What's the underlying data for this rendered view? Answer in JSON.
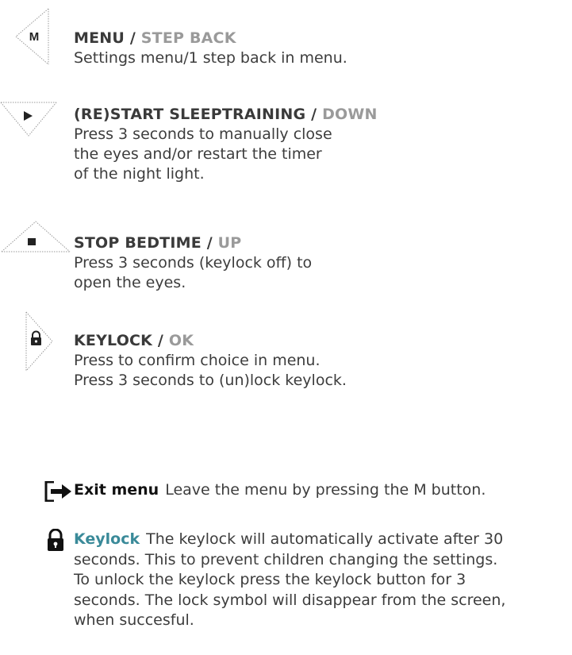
{
  "buttons": [
    {
      "icon": "menu-button-icon",
      "glyph": "M",
      "title_main": "MENU / ",
      "title_alt": "STEP BACK",
      "lines": [
        "Settings menu/1 step back in menu."
      ]
    },
    {
      "icon": "play-button-icon",
      "glyph": "▶",
      "title_main": "(RE)START SLEEPTRAINING / ",
      "title_alt": "DOWN",
      "lines": [
        "Press 3 seconds to manually close",
        "the eyes and/or restart the timer",
        "of the night light."
      ]
    },
    {
      "icon": "stop-button-icon",
      "glyph": "■",
      "title_main": "STOP BEDTIME / ",
      "title_alt": "UP",
      "lines": [
        "Press 3 seconds (keylock off) to",
        "open the eyes."
      ]
    },
    {
      "icon": "lock-button-icon",
      "glyph": "lock",
      "title_main": "KEYLOCK / ",
      "title_alt": "OK",
      "lines": [
        "Press to confirm choice in menu.",
        "Press 3 seconds to (un)lock keylock."
      ]
    }
  ],
  "notes": {
    "exit": {
      "icon": "exit-icon",
      "label": "Exit menu",
      "text": "Leave the menu by pressing the M button."
    },
    "keylock": {
      "icon": "lock-icon",
      "label": "Keylock",
      "lines": [
        "The keylock will automatically activate after 30",
        "seconds. This to prevent children changing the settings.",
        "To unlock the keylock press the keylock button for 3",
        "seconds. The lock symbol will disappear from the screen,",
        "when succesful."
      ]
    }
  },
  "colors": {
    "text": "#3d3d3d",
    "alt": "#9a9a9a",
    "keylock_accent": "#3a8a99"
  }
}
